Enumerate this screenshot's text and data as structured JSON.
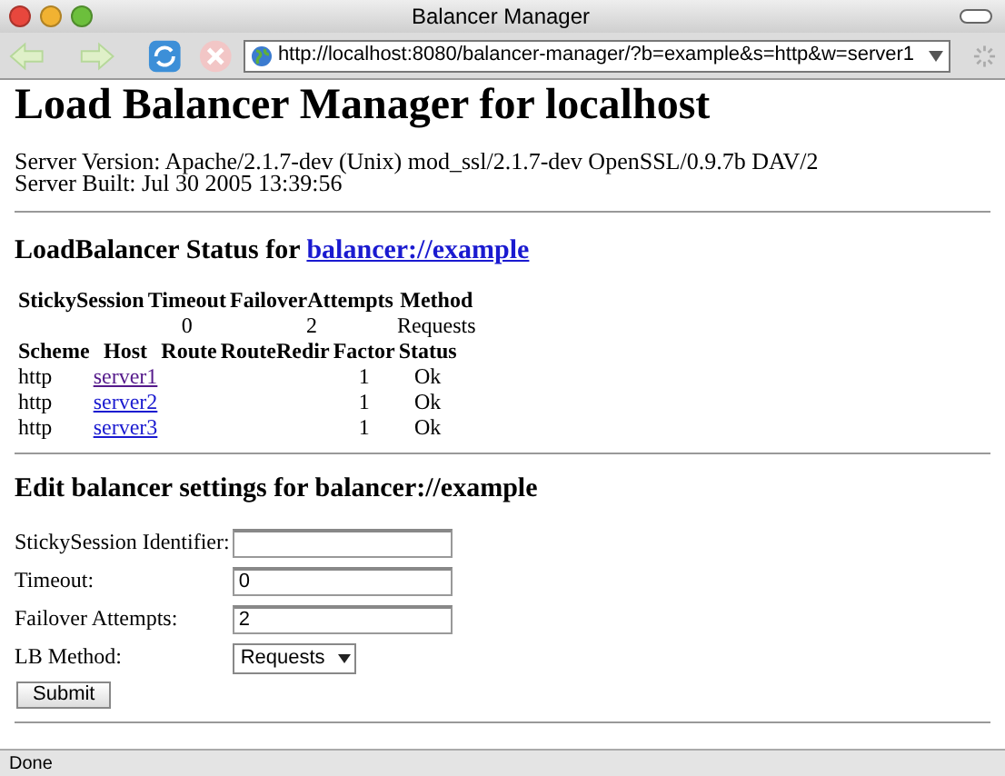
{
  "window": {
    "title": "Balancer Manager"
  },
  "toolbar": {
    "url": "http://localhost:8080/balancer-manager/?b=example&s=http&w=server1"
  },
  "page": {
    "heading": "Load Balancer Manager for localhost",
    "server_info": [
      "Server Version: Apache/2.1.7-dev (Unix) mod_ssl/2.1.7-dev OpenSSL/0.9.7b DAV/2",
      "Server Built: Jul 30 2005 13:39:56"
    ],
    "status_heading": "LoadBalancer Status for ",
    "status_link": "balancer://example",
    "balancer_table": {
      "columns": [
        "StickySession",
        "Timeout",
        "FailoverAttempts",
        "Method"
      ],
      "rows": [
        [
          "",
          "0",
          "2",
          "Requests"
        ]
      ]
    },
    "worker_table": {
      "columns": [
        "Scheme",
        "Host",
        "Route",
        "RouteRedir",
        "Factor",
        "Status"
      ],
      "rows": [
        {
          "scheme": "http",
          "host": "server1",
          "route": "",
          "route_redir": "",
          "factor": "1",
          "status": "Ok",
          "visited": true
        },
        {
          "scheme": "http",
          "host": "server2",
          "route": "",
          "route_redir": "",
          "factor": "1",
          "status": "Ok",
          "visited": false
        },
        {
          "scheme": "http",
          "host": "server3",
          "route": "",
          "route_redir": "",
          "factor": "1",
          "status": "Ok",
          "visited": false
        }
      ]
    },
    "edit_heading": "Edit balancer settings for balancer://example",
    "form": [
      {
        "kind": "text",
        "label": "StickySession Identifier:"
      },
      {
        "kind": "text",
        "label": "Timeout:",
        "value": "0"
      },
      {
        "kind": "text",
        "label": "Failover Attempts:",
        "value": "2"
      },
      {
        "kind": "select",
        "label": "LB Method:",
        "value": "Requests"
      }
    ],
    "submit": "Submit"
  },
  "status_bar": "Done"
}
